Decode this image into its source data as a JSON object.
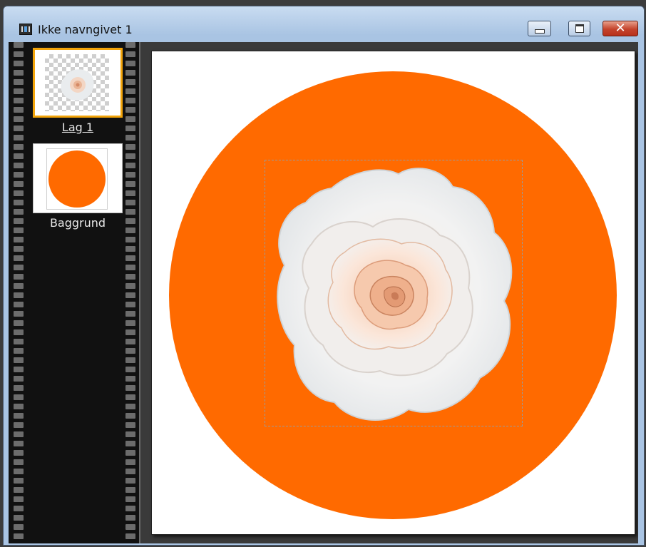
{
  "window": {
    "title": "Ikke navngivet 1",
    "controls": {
      "minimize": "minimize",
      "maximize": "maximize",
      "close": "✕"
    }
  },
  "layers": [
    {
      "name": "Lag 1",
      "selected": true,
      "thumbnail": "rose-on-transparent"
    },
    {
      "name": "Baggrund",
      "selected": false,
      "thumbnail": "orange-circle"
    }
  ],
  "canvas": {
    "background_color": "#ffffff",
    "circle_color": "#ff6a00",
    "has_selection": true,
    "layer_image": "white-peach-rose"
  },
  "colors": {
    "accent_selected_layer": "#f2a40a",
    "panel_bg": "#111111",
    "workspace_bg": "#3a3a3a"
  }
}
